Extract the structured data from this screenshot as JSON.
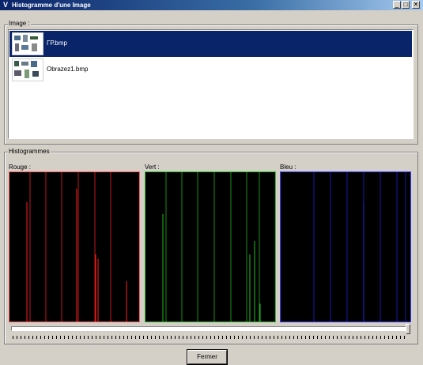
{
  "window": {
    "title": "Histogramme d'une Image",
    "buttons": {
      "minimize": "_",
      "maximize": "□",
      "close": "✕"
    }
  },
  "image_group": {
    "label": "Image :",
    "items": [
      {
        "label": "ГР.bmp",
        "selected": true
      },
      {
        "label": "Obrazez1.bmp",
        "selected": false
      }
    ]
  },
  "histo_group": {
    "label": "Histogrammes",
    "panels": [
      {
        "label": "Rouge :",
        "color": "#ff2020",
        "border": "#ff6060",
        "gridlines": [
          26,
          46,
          66,
          87,
          108,
          128
        ],
        "spikes": [
          [
            22,
            80
          ],
          [
            85,
            89
          ],
          [
            109,
            45
          ],
          [
            112,
            42
          ],
          [
            148,
            27
          ]
        ]
      },
      {
        "label": "Vert :",
        "color": "#20c020",
        "border": "#30c030",
        "gridlines": [
          26,
          46,
          66,
          87,
          108,
          128,
          144
        ],
        "spikes": [
          [
            22,
            72
          ],
          [
            132,
            45
          ],
          [
            138,
            54
          ],
          [
            145,
            12
          ]
        ]
      },
      {
        "label": "Bleu :",
        "color": "#2020e0",
        "border": "#4040ff",
        "gridlines": [
          42,
          63,
          84,
          105,
          126,
          147,
          158
        ],
        "spikes": [
          [
            105,
            80
          ]
        ]
      }
    ]
  },
  "slider": {
    "value": 1.0
  },
  "close_button": "Fermer"
}
